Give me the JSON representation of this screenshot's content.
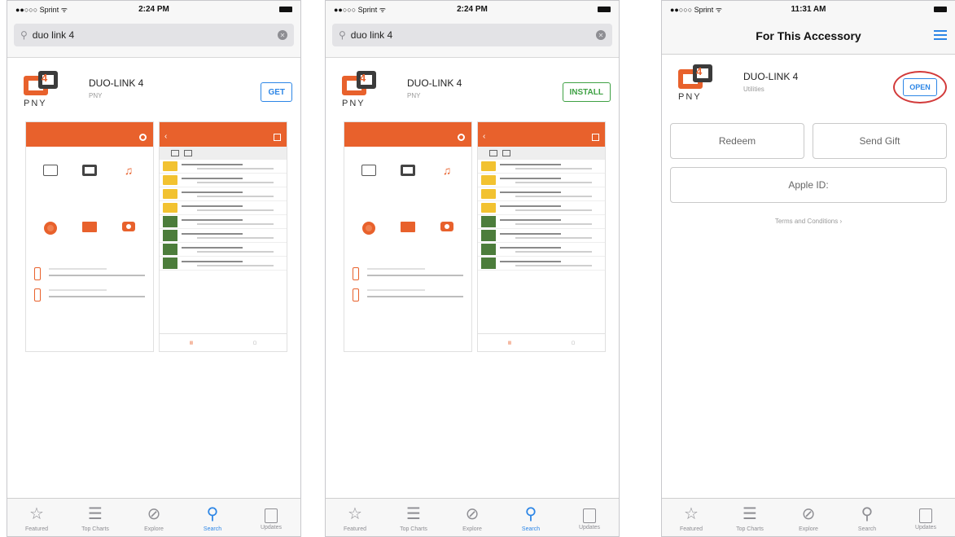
{
  "status": {
    "carrier": "●●○○○ Sprint ᯤ",
    "time_search": "2:24 PM",
    "time_accessory": "11:31 AM"
  },
  "search": {
    "query": "duo link 4"
  },
  "app": {
    "name": "DUO-LINK 4",
    "publisher": "PNY",
    "category": "Utilities",
    "brand_logo_text": "PNY"
  },
  "buttons": {
    "get": "GET",
    "install": "INSTALL",
    "open": "OPEN"
  },
  "accessory": {
    "title": "For This Accessory",
    "redeem": "Redeem",
    "send_gift": "Send Gift",
    "apple_id": "Apple ID:",
    "terms": "Terms and Conditions ›"
  },
  "tabs": [
    {
      "label": "Featured",
      "icon": "star-icon"
    },
    {
      "label": "Top Charts",
      "icon": "list-icon"
    },
    {
      "label": "Explore",
      "icon": "compass-icon"
    },
    {
      "label": "Search",
      "icon": "search-icon"
    },
    {
      "label": "Updates",
      "icon": "download-icon"
    }
  ],
  "colors": {
    "accent_blue": "#2d86e6",
    "install_green": "#3fa144",
    "brand_orange": "#e8612c",
    "highlight_red": "#d23a3a"
  }
}
